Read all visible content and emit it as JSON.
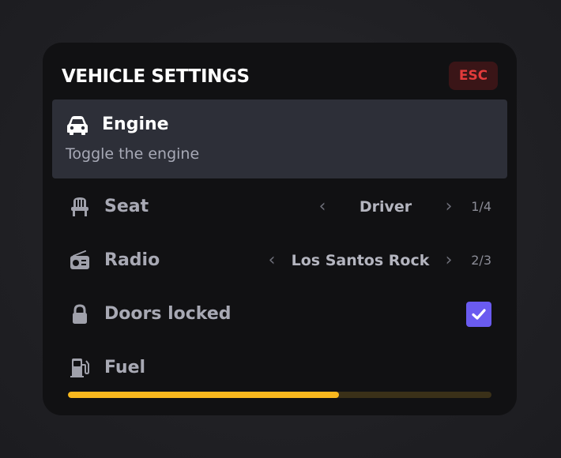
{
  "header": {
    "title": "VEHICLE SETTINGS",
    "close_label": "ESC"
  },
  "items": {
    "engine": {
      "label": "Engine",
      "description": "Toggle the engine",
      "icon": "car-icon"
    },
    "seat": {
      "label": "Seat",
      "value": "Driver",
      "count": "1/4",
      "icon": "seat-icon"
    },
    "radio": {
      "label": "Radio",
      "value": "Los Santos Rock",
      "count": "2/3",
      "icon": "radio-icon"
    },
    "doors": {
      "label": "Doors locked",
      "checked": true,
      "icon": "lock-icon"
    },
    "fuel": {
      "label": "Fuel",
      "level": 0.64,
      "icon": "fuel-pump-icon"
    }
  },
  "colors": {
    "panel_bg": "#111113",
    "active_item_bg": "#2d2f38",
    "esc_bg": "#3a1517",
    "esc_text": "#e23b3b",
    "checkbox": "#6a5bf0",
    "fuel_fill": "#f9b81e",
    "fuel_track": "#3a3018"
  }
}
